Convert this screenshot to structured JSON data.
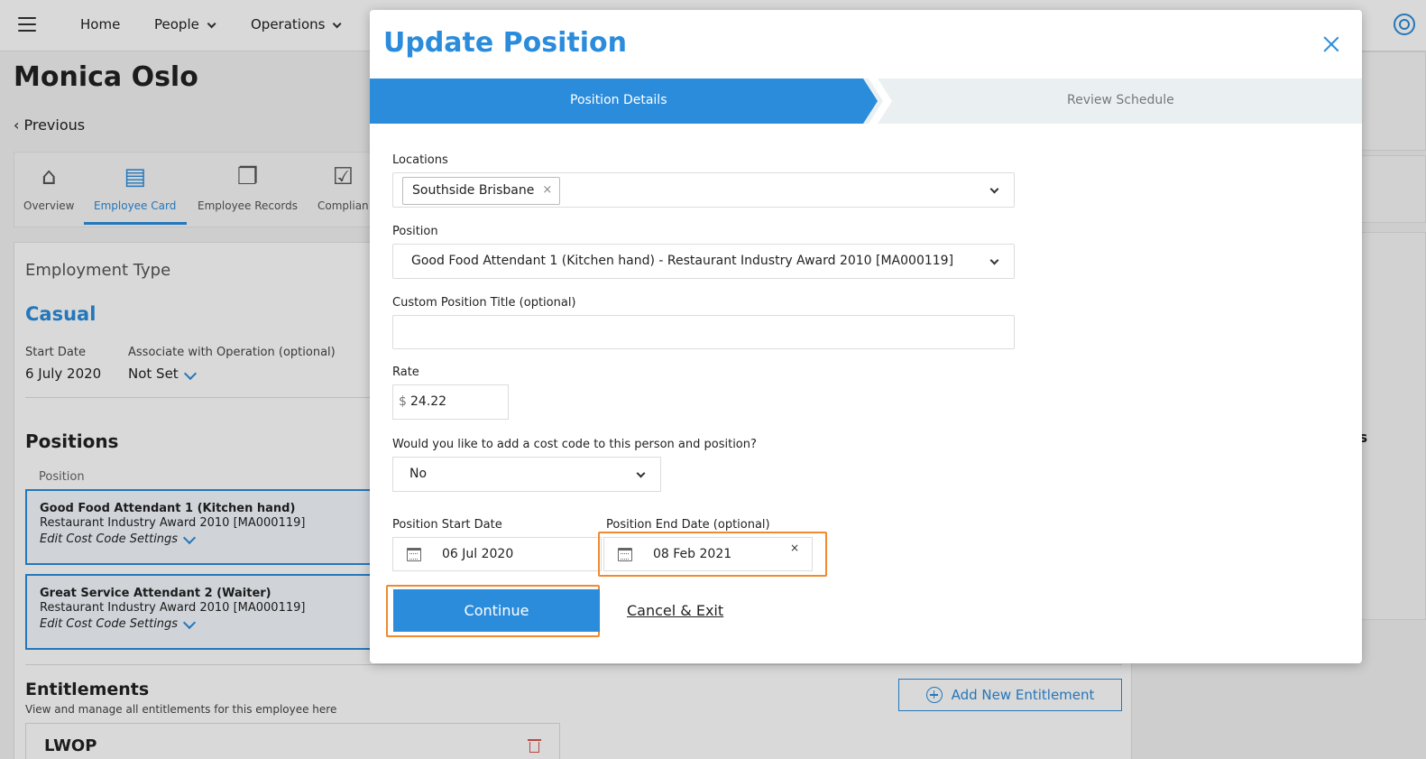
{
  "nav": {
    "items": [
      {
        "label": "Home"
      },
      {
        "label": "People"
      },
      {
        "label": "Operations"
      }
    ]
  },
  "page": {
    "title": "Monica Oslo",
    "previous_label": "Previous"
  },
  "tabs": [
    {
      "label": "Overview",
      "icon": "home-icon"
    },
    {
      "label": "Employee Card",
      "icon": "id-card-icon"
    },
    {
      "label": "Employee Records",
      "icon": "documents-icon"
    },
    {
      "label": "Complian",
      "icon": "checklist-icon"
    }
  ],
  "employment": {
    "type_label": "Employment Type",
    "type_value": "Casual",
    "start_date_label": "Start Date",
    "start_date_value": "6 July 2020",
    "operation_label": "Associate with Operation (optional)",
    "operation_value": "Not Set"
  },
  "positions": {
    "title": "Positions",
    "column_header": "Position",
    "items": [
      {
        "title": "Good Food Attendant 1 (Kitchen hand)",
        "award": "Restaurant Industry Award 2010 [MA000119]",
        "edit_label": "Edit Cost Code Settings"
      },
      {
        "title": "Great Service Attendant 2 (Waiter)",
        "award": "Restaurant Industry Award 2010 [MA000119]",
        "edit_label": "Edit Cost Code Settings"
      }
    ]
  },
  "entitlements": {
    "title": "Entitlements",
    "subtitle": "View and manage all entitlements for this employee here",
    "add_label": "Add New Entitlement",
    "first_item": "LWOP"
  },
  "right_panel": {
    "partial_heading": "ms"
  },
  "modal": {
    "title": "Update Position",
    "steps": [
      {
        "label": "Position Details",
        "active": true
      },
      {
        "label": "Review Schedule",
        "active": false
      }
    ],
    "locations": {
      "label": "Locations",
      "selected": "Southside Brisbane",
      "chip_remove": "×"
    },
    "position": {
      "label": "Position",
      "value": "Good Food Attendant 1 (Kitchen hand) - Restaurant Industry Award 2010 [MA000119]"
    },
    "custom_title": {
      "label": "Custom Position Title (optional)",
      "value": ""
    },
    "rate": {
      "label": "Rate",
      "currency": "$",
      "value": "24.22"
    },
    "cost_code": {
      "label": "Would you like to add a cost code to this person and position?",
      "value": "No"
    },
    "start_date": {
      "label": "Position Start Date",
      "value": "06 Jul 2020"
    },
    "end_date": {
      "label": "Position End Date (optional)",
      "value": "08 Feb 2021",
      "clear": "×"
    },
    "continue_label": "Continue",
    "cancel_label": "Cancel & Exit"
  },
  "colors": {
    "accent": "#2b8cdc",
    "highlight": "#ef8a2f",
    "danger": "#d9534f"
  }
}
